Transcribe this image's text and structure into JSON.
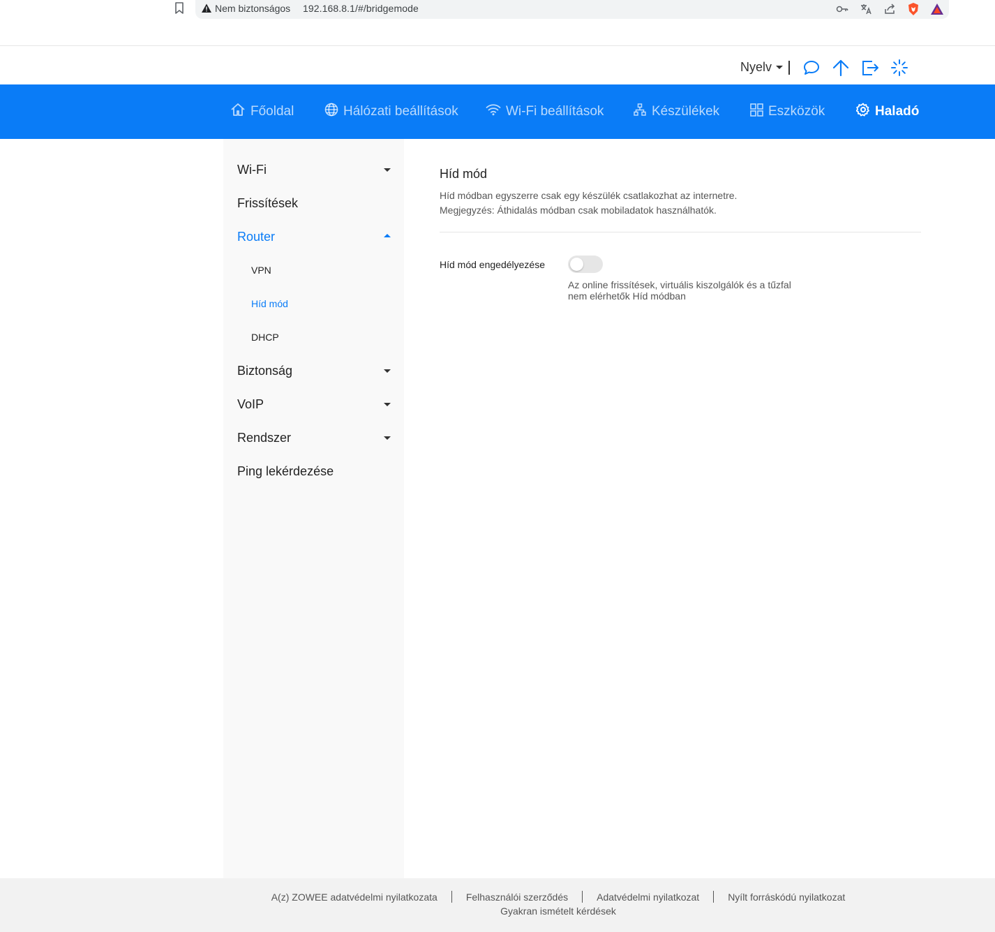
{
  "browser": {
    "security_label": "Nem biztonságos",
    "url": "192.168.8.1/#/bridgemode",
    "icons": [
      "bookmark-icon",
      "warning-icon",
      "key-icon",
      "translate-icon",
      "share-icon",
      "brave-shield-icon",
      "brave-rewards-icon"
    ]
  },
  "utility": {
    "language_label": "Nyelv",
    "icons": [
      "message-icon",
      "upload-icon",
      "logout-icon",
      "loading-icon"
    ]
  },
  "nav": {
    "items": [
      {
        "label": "Főoldal",
        "icon": "home-icon"
      },
      {
        "label": "Hálózati beállítások",
        "icon": "globe-icon"
      },
      {
        "label": "Wi-Fi beállítások",
        "icon": "wifi-icon"
      },
      {
        "label": "Készülékek",
        "icon": "devices-icon"
      },
      {
        "label": "Eszközök",
        "icon": "tools-icon"
      },
      {
        "label": "Haladó",
        "icon": "gear-icon",
        "active": true
      }
    ]
  },
  "sidebar": {
    "items": [
      {
        "label": "Wi-Fi",
        "expandable": true
      },
      {
        "label": "Frissítések"
      },
      {
        "label": "Router",
        "expanded": true,
        "active": true
      },
      {
        "label": "Biztonság",
        "expandable": true
      },
      {
        "label": "VoIP",
        "expandable": true
      },
      {
        "label": "Rendszer",
        "expandable": true
      },
      {
        "label": "Ping lekérdezése"
      }
    ],
    "router_subitems": [
      {
        "label": "VPN"
      },
      {
        "label": "Híd mód",
        "active": true
      },
      {
        "label": "DHCP"
      }
    ]
  },
  "content": {
    "title": "Híd mód",
    "description_1": "Híd módban egyszerre csak egy készülék csatlakozhat az internetre.",
    "description_2": "Megjegyzés: Áthidalás módban csak mobiladatok használhatók.",
    "toggle_label": "Híd mód engedélyezése",
    "toggle_on": false,
    "hint_1": "Az online frissítések, virtuális kiszolgálók és a tűzfal",
    "hint_2": "nem elérhetők Híd módban"
  },
  "footer": {
    "links": [
      "A(z) ZOWEE adatvédelmi nyilatkozata",
      "Felhasználói szerződés",
      "Adatvédelmi nyilatkozat",
      "Nyílt forráskódú nyilatkozat"
    ],
    "faq": "Gyakran ismételt kérdések"
  },
  "colors": {
    "accent": "#0a7cf7",
    "sidebar_bg": "#f9f9f9",
    "footer_bg": "#f2f2f2"
  }
}
